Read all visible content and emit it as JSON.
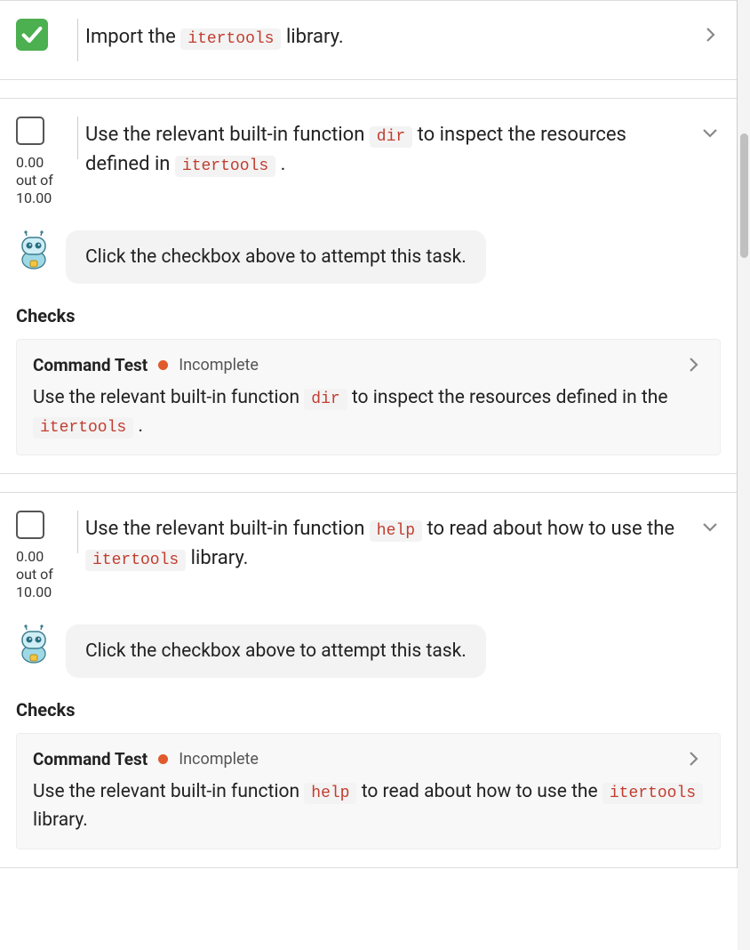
{
  "tasks": [
    {
      "done": true,
      "desc_segments": [
        {
          "t": "text",
          "v": "Import the "
        },
        {
          "t": "code",
          "v": "itertools"
        },
        {
          "t": "text",
          "v": " library."
        }
      ],
      "chevron": "right",
      "expanded": false
    },
    {
      "done": false,
      "score_current": "0.00",
      "score_label": "out of",
      "score_max": "10.00",
      "desc_segments": [
        {
          "t": "text",
          "v": "Use the relevant built-in function "
        },
        {
          "t": "code",
          "v": "dir"
        },
        {
          "t": "text",
          "v": " to inspect the resources defined in "
        },
        {
          "t": "code",
          "v": "itertools"
        },
        {
          "t": "text",
          "v": " ."
        }
      ],
      "chevron": "down",
      "expanded": true,
      "bot_message": "Click the checkbox above to attempt this task.",
      "checks_heading": "Checks",
      "check": {
        "title": "Command Test",
        "status": "Incomplete",
        "body_segments": [
          {
            "t": "text",
            "v": "Use the relevant built-in function "
          },
          {
            "t": "code",
            "v": "dir"
          },
          {
            "t": "text",
            "v": " to inspect the resources defined in the "
          },
          {
            "t": "code",
            "v": "itertools"
          },
          {
            "t": "text",
            "v": " ."
          }
        ]
      }
    },
    {
      "done": false,
      "score_current": "0.00",
      "score_label": "out of",
      "score_max": "10.00",
      "desc_segments": [
        {
          "t": "text",
          "v": "Use the relevant built-in function "
        },
        {
          "t": "code",
          "v": "help"
        },
        {
          "t": "text",
          "v": " to read about how to use the "
        },
        {
          "t": "code",
          "v": "itertools"
        },
        {
          "t": "text",
          "v": " library."
        }
      ],
      "chevron": "down",
      "expanded": true,
      "bot_message": "Click the checkbox above to attempt this task.",
      "checks_heading": "Checks",
      "check": {
        "title": "Command Test",
        "status": "Incomplete",
        "body_segments": [
          {
            "t": "text",
            "v": "Use the relevant built-in function "
          },
          {
            "t": "code",
            "v": "help"
          },
          {
            "t": "text",
            "v": " to read about how to use the "
          },
          {
            "t": "code",
            "v": "itertools"
          },
          {
            "t": "text",
            "v": " library."
          }
        ]
      }
    }
  ]
}
